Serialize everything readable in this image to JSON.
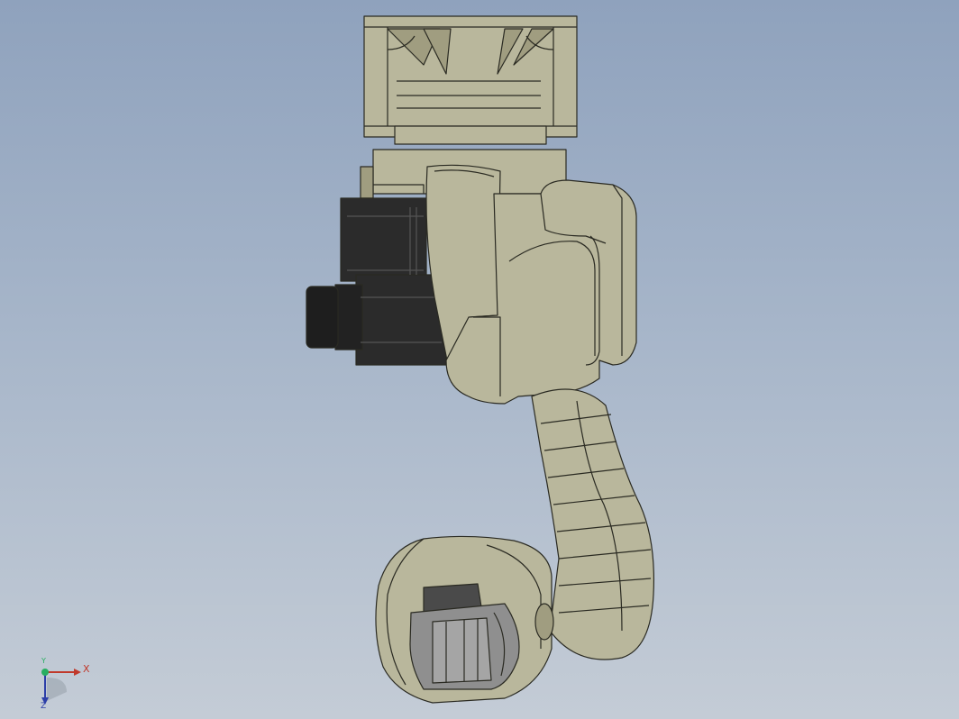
{
  "viewport": {
    "background_top": "#8fa2bd",
    "background_bottom": "#c4ccd6",
    "model": {
      "description_icon": "robot-arm-model",
      "body_color": "#b9b79c",
      "shadow_color": "#a09d80",
      "edge_color": "#2a2a22",
      "motor_color": "#2b2b2b",
      "flange_color": "#8f8f8f"
    }
  },
  "triad": {
    "x_label": "X",
    "y_label": "Y",
    "z_label": "Z",
    "x_color": "#c0392b",
    "y_color": "#27ae60",
    "z_color": "#2c3ea8"
  }
}
